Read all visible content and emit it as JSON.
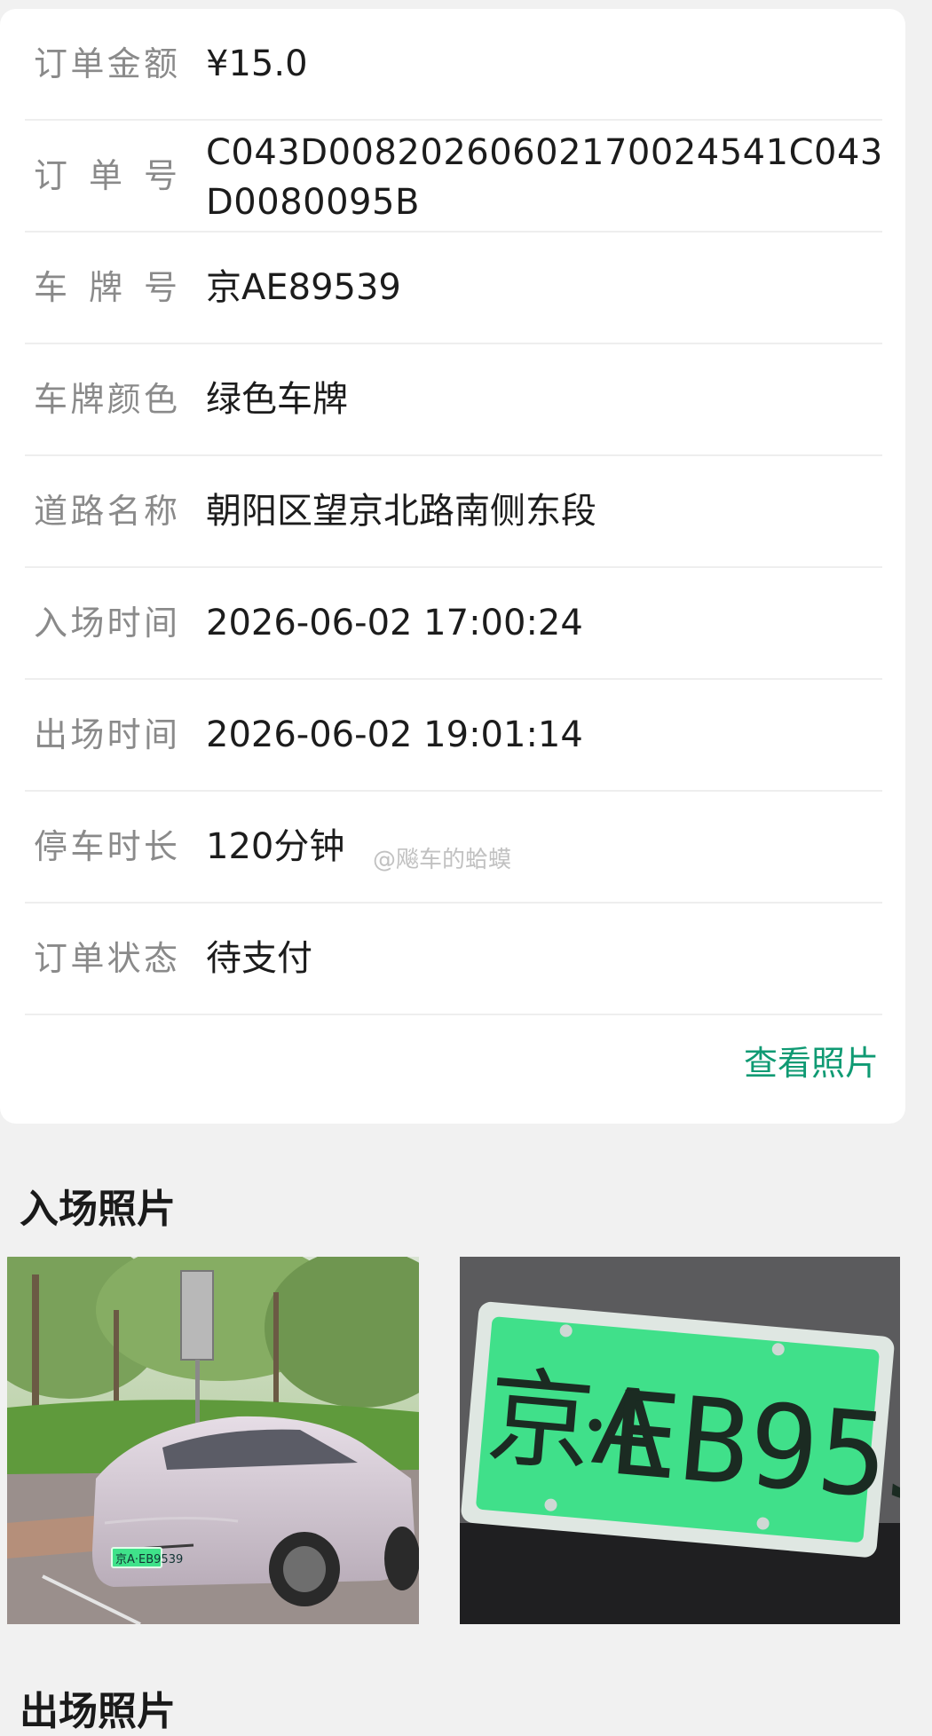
{
  "order": {
    "rows": [
      {
        "label": "订单金额",
        "value": "¥15.0"
      },
      {
        "label": "订 单 号",
        "value": "C043D00820260602170024541C043D0080095B"
      },
      {
        "label": "车 牌 号",
        "value": "京AE89539"
      },
      {
        "label": "车牌颜色",
        "value": "绿色车牌"
      },
      {
        "label": "道路名称",
        "value": "朝阳区望京北路南侧东段"
      },
      {
        "label": "入场时间",
        "value": "2026-06-02 17:00:24"
      },
      {
        "label": "出场时间",
        "value": "2026-06-02 19:01:14"
      },
      {
        "label": "停车时长",
        "value": "120分钟"
      },
      {
        "label": "订单状态",
        "value": "待支付"
      }
    ],
    "view_photo_label": "查看照片"
  },
  "entry_section": {
    "title": "入场照片",
    "plate_text": "京A·EB9539"
  },
  "exit_section": {
    "title": "出场照片"
  },
  "watermark": "@飚车的蛤蟆",
  "colors": {
    "accent": "#0f9a73",
    "plate_green": "#3fe28a"
  }
}
